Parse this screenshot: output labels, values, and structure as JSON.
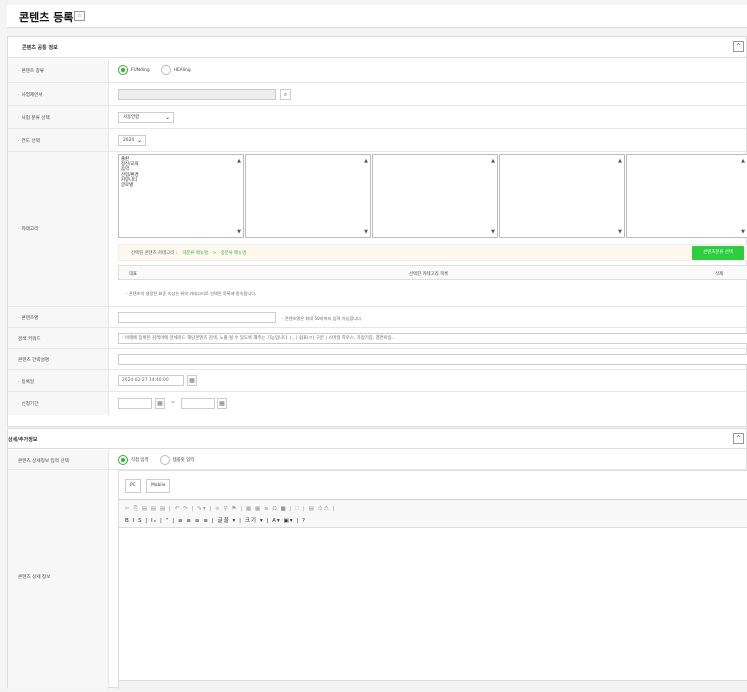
{
  "header": {
    "title": "콘텐츠 등록",
    "star": "☆"
  },
  "common": {
    "title": "콘텐츠 공통 정보",
    "collapse": "^",
    "type_label": "콘텐츠 종류",
    "type_opt1": "FUNding",
    "type_opt2": "HEAling",
    "provider_label": "사업제안서",
    "class_label": "사업 분류 선택",
    "class_value": "사용안함",
    "year_label": "연도 선택",
    "year_value": "2024",
    "category_label": "카테고리",
    "categories": [
      "출판",
      "정신/교육",
      "음악",
      "산업/환경",
      "커뮤니티",
      "글로벌"
    ],
    "selected_label": "선택된 콘텐츠 카테고리 :",
    "selected_path1": "대분류 메뉴명",
    "selected_sep": ">",
    "selected_path2": "중분류 메뉴명",
    "cat_select_btn": "콘텐츠분류 선택",
    "col_rep": "대표",
    "col_selected": "선택한 카테고리 목록",
    "col_delete": "삭제",
    "cat_help": "- 콘텐츠의 설정된 표준 속성은 위의 카테고리로 선택된 목록에 종속됩니다.",
    "name_label": "콘텐츠명",
    "name_help": "- 콘텐츠명은 최대 50자까지 입력 가능합니다.",
    "keyword_label": "검색 키워드",
    "keyword_placeholder": "- 아래에 등록된 검색어에 전체카드 해당콘텐츠 검색, 노출 될 수 있도록 해주는 기능입니다. ( , ) 쉼표(ㅇ) 구분 | 스마일 하우스, 가정기증, 결연아동...",
    "intro_label": "콘텐츠 간략설명",
    "date_label": "등록일",
    "date_value": "2024-02-27 14:40:00",
    "period_label": "신청기간",
    "period_sep": "~"
  },
  "detail": {
    "title": "상세/추가정보",
    "collapse": "^",
    "input_label": "콘텐츠 상세정보 입력 선택",
    "opt1": "직접 입력",
    "opt2": "템플릿 입력",
    "tab_pc": "PC",
    "tab_mobile": "Mobile",
    "detail_label": "콘텐츠 상세 정보",
    "toolbar1": "✂ ⎘ ▤ ▤ ▤ | ↶ ↷ | ✎▾ | ∞ ⚲ ⚑ | ▦ ▦ ≡ Ω ■ | ⛶ | ▤ 소스 |",
    "toolbar2": "B I S | Iₓ | ” | ≡ ≡ ≡ ≡ | 글꼴 ▾ | 크기 ▾ | A▾ ▣▾ | ?"
  }
}
